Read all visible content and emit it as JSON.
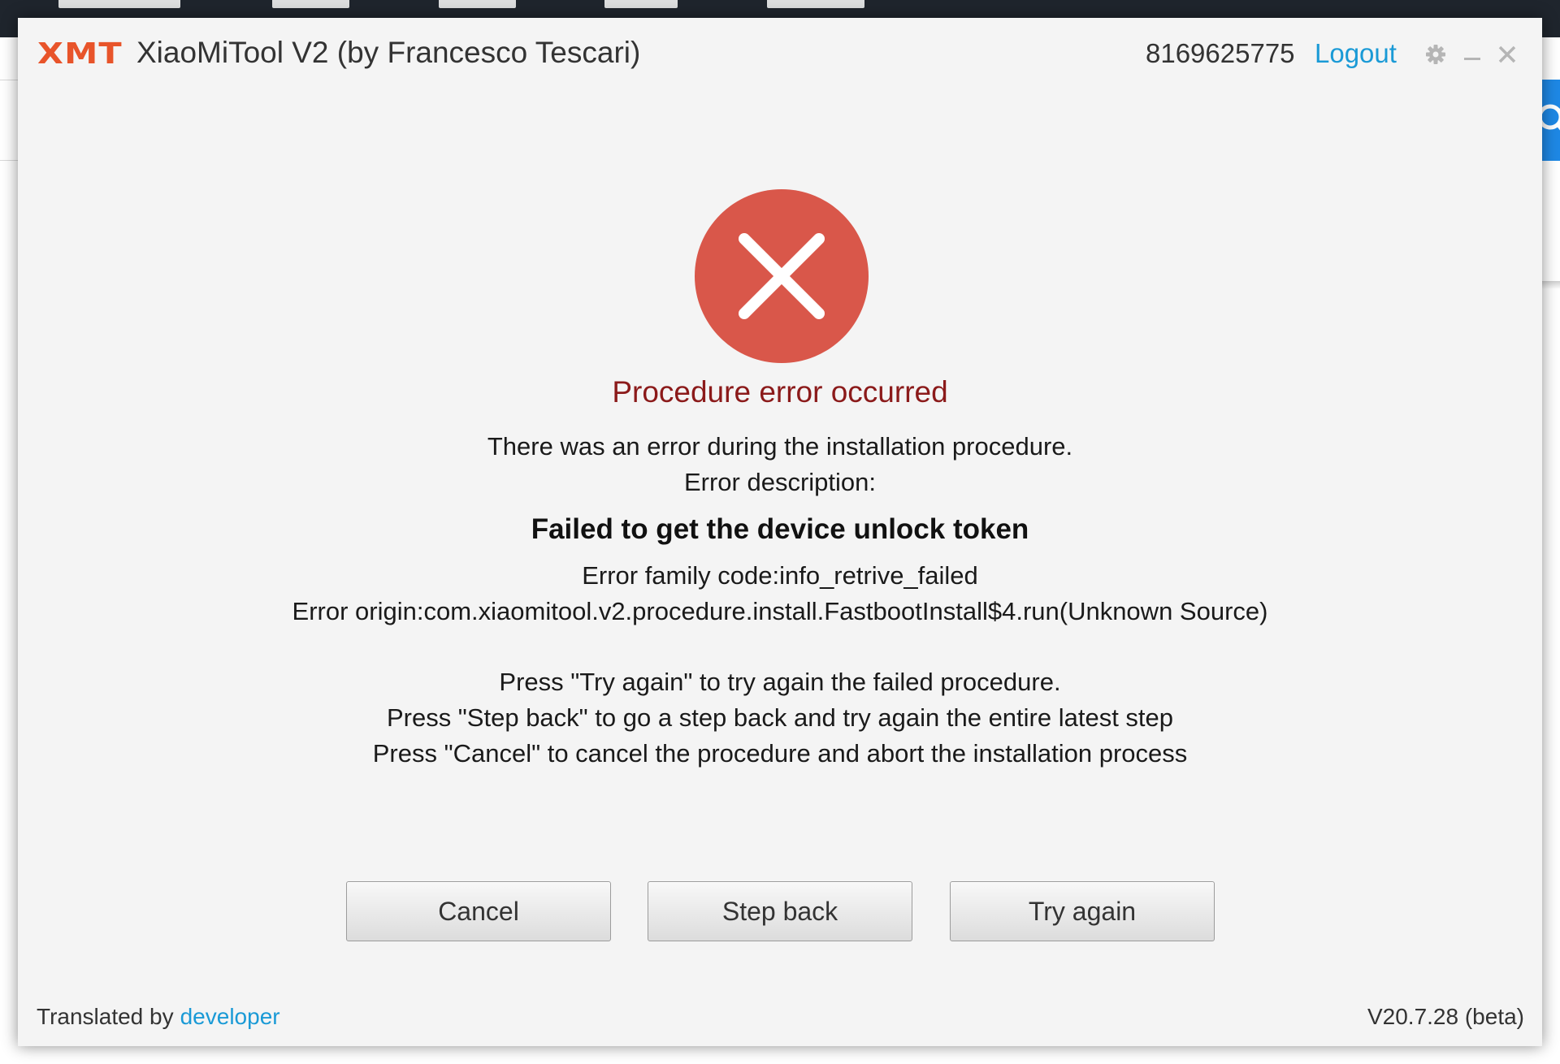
{
  "window": {
    "logo": "XMT",
    "title": "XiaoMiTool V2 (by Francesco Tescari)",
    "user_id": "8169625775",
    "logout_label": "Logout"
  },
  "error": {
    "title": "Procedure error occurred",
    "line1": "There was an error during the installation procedure.",
    "line2": "Error description:",
    "description": "Failed to get the device unlock token",
    "family_code": "Error family code:info_retrive_failed",
    "origin": "Error origin:com.xiaomitool.v2.procedure.install.FastbootInstall$4.run(Unknown Source)",
    "help_try_again": "Press \"Try again\" to try again the failed procedure.",
    "help_step_back": "Press \"Step back\" to go a step back and try again the entire latest step",
    "help_cancel": "Press \"Cancel\" to cancel the procedure and abort the installation process"
  },
  "buttons": {
    "cancel": "Cancel",
    "step_back": "Step back",
    "try_again": "Try again"
  },
  "footer": {
    "translated_by": "Translated by",
    "translator": "developer",
    "version": "V20.7.28 (beta)"
  },
  "colors": {
    "accent_orange": "#e8542a",
    "link_blue": "#1a9ad6",
    "error_red": "#d9574a",
    "error_title": "#8b1a1a",
    "window_bg": "#f4f4f4"
  },
  "icons": [
    "gear-icon",
    "minimize-icon",
    "close-icon",
    "error-x-icon",
    "search-icon"
  ]
}
